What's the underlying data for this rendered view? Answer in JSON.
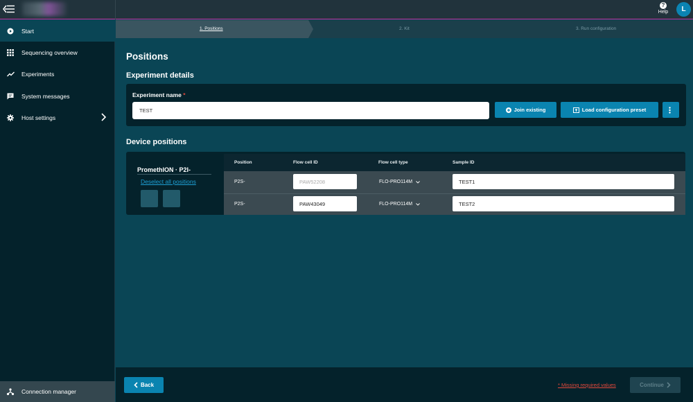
{
  "header": {
    "help_label": "Help",
    "help_icon_glyph": "?",
    "avatar_initial": "L"
  },
  "sidebar": {
    "items": [
      {
        "label": "Start",
        "icon": "play-circle-icon",
        "active": true
      },
      {
        "label": "Sequencing overview",
        "icon": "grid-icon"
      },
      {
        "label": "Experiments",
        "icon": "trend-line-icon"
      },
      {
        "label": "System messages",
        "icon": "message-icon"
      },
      {
        "label": "Host settings",
        "icon": "gear-icon",
        "has_submenu": true
      }
    ],
    "connection_manager": "Connection manager"
  },
  "stepper": {
    "steps": [
      "1. Positions",
      "2. Kit",
      "3. Run configuration"
    ],
    "current": 0
  },
  "main": {
    "title": "Positions",
    "experiment_details": {
      "heading": "Experiment details",
      "name_label": "Experiment name",
      "required_mark": "*",
      "name_value": "TEST",
      "join_existing": "Join existing",
      "load_preset": "Load configuration preset"
    },
    "device_positions": {
      "heading": "Device positions",
      "device_name": "PromethION · P2I-",
      "deselect_all": "Deselect all positions",
      "columns": [
        "Position",
        "Flow cell ID",
        "Flow cell type",
        "Sample ID"
      ],
      "rows": [
        {
          "position": "P2S-",
          "flow_cell_id_placeholder": "PAW52208",
          "flow_cell_id": "",
          "flow_cell_type": "FLO-PRO114M",
          "sample_id": "TEST1"
        },
        {
          "position": "P2S-",
          "flow_cell_id_placeholder": "",
          "flow_cell_id": "PAW43049",
          "flow_cell_type": "FLO-PRO114M",
          "sample_id": "TEST2"
        }
      ]
    }
  },
  "footer": {
    "back": "Back",
    "missing": "* Missing required values",
    "continue": "Continue"
  },
  "colors": {
    "accent": "#0a84b0",
    "required": "#e2483b",
    "link": "#1ea0d5",
    "main_bg": "#0a4555",
    "sidebar_bg": "#04222b"
  }
}
